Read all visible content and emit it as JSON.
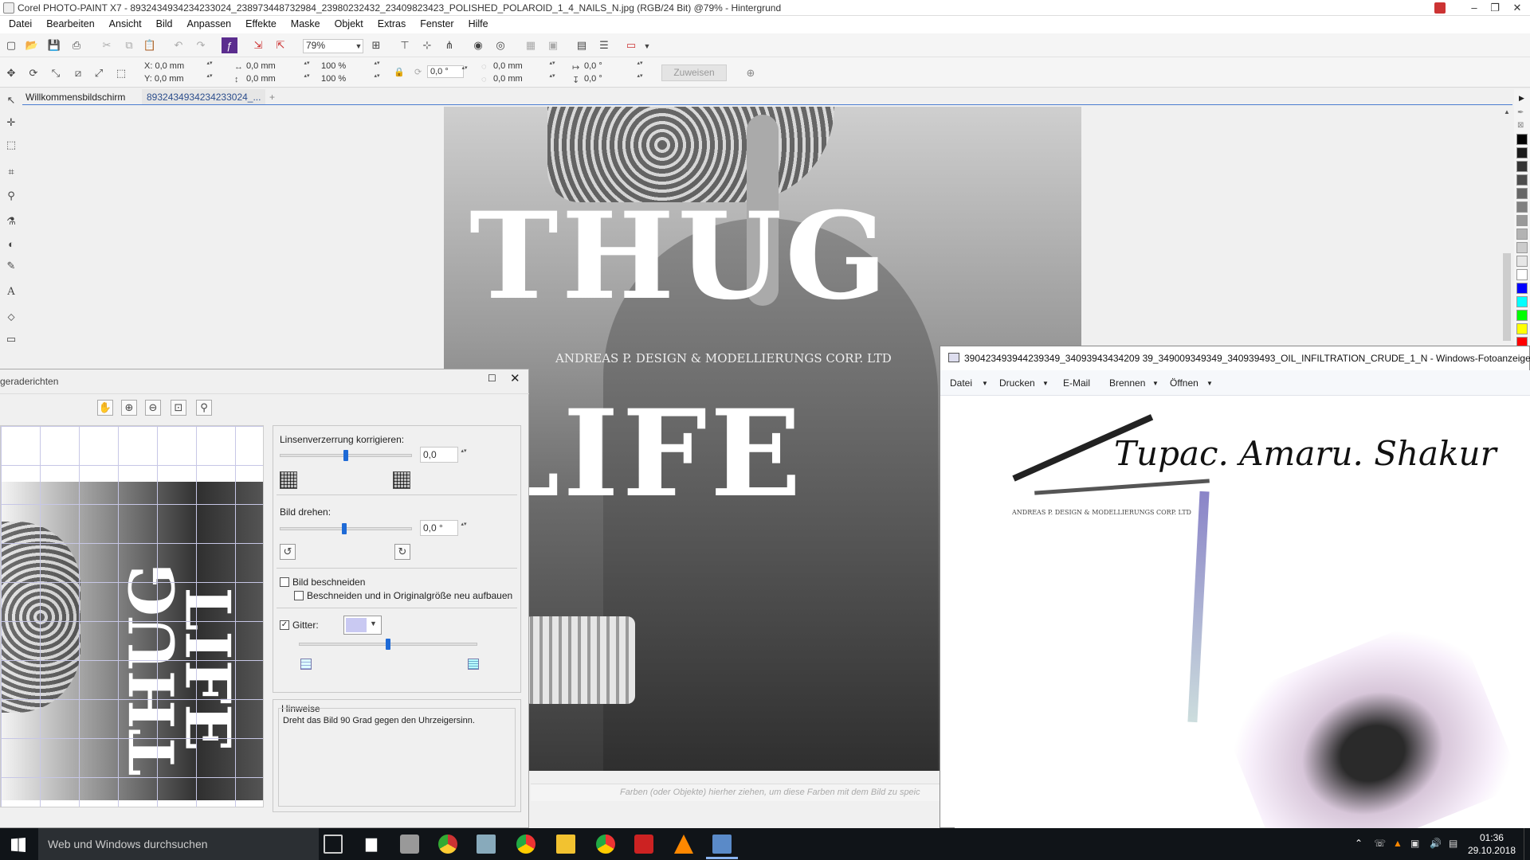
{
  "window": {
    "title": "Corel PHOTO-PAINT X7 - 8932434934234233024_238973448732984_23980232432_23409823423_POLISHED_POLAROID_1_4_NAILS_N.jpg (RGB/24 Bit) @79% - Hintergrund",
    "min": "–",
    "max": "❐",
    "close": "✕"
  },
  "menu": [
    "Datei",
    "Bearbeiten",
    "Ansicht",
    "Bild",
    "Anpassen",
    "Effekte",
    "Maske",
    "Objekt",
    "Extras",
    "Fenster",
    "Hilfe"
  ],
  "toolbar": {
    "zoom": "79%",
    "apply_label": "Zuweisen"
  },
  "props": {
    "x": "X: 0,0 mm",
    "y": "Y: 0,0 mm",
    "w": "0,0 mm",
    "h": "0,0 mm",
    "sx": "100 %",
    "sy": "100 %",
    "rot": "0,0 °",
    "cx": "0,0 mm",
    "cy": "0,0 mm",
    "skx": "0,0 °",
    "sky": "0,0 °"
  },
  "tabs": {
    "welcome": "Willkommensbildschirm",
    "doc": "8932434934234233024_...",
    "add": "+"
  },
  "canvas": {
    "thug": "THUG",
    "life": "LIFE",
    "credit": "ANDREAS P. DESIGN & MODELLIERUNGS CORP. LTD",
    "colorbar_hint": "Farben (oder Objekte) hierher ziehen, um diese Farben mit dem Bild zu speic"
  },
  "palette_colors": [
    "#000000",
    "#1a1a1a",
    "#333333",
    "#4d4d4d",
    "#666666",
    "#808080",
    "#999999",
    "#b3b3b3",
    "#cccccc",
    "#e6e6e6",
    "#ffffff",
    "#0000ff",
    "#00ffff",
    "#00ff00",
    "#ffff00",
    "#ff0000"
  ],
  "dialog": {
    "title": "geraderichten",
    "lens_label": "Linsenverzerrung korrigieren:",
    "lens_value": "0,0",
    "rotate_label": "Bild drehen:",
    "rotate_value": "0,0 °",
    "crop_label": "Bild beschneiden",
    "crop_rebuild_label": "Beschneiden und in Originalgröße neu aufbauen",
    "grid_label": "Gitter:",
    "grid_color": "#c9c9f2",
    "hints_title": "Hinweise",
    "hints_text": "Dreht das Bild 90 Grad gegen den Uhrzeigersinn.",
    "lens_level": 0.5,
    "rotate_level": 0.49,
    "grid_level": 0.5
  },
  "viewer": {
    "title": "390423493944239349_34093943434209 39_349009349349_340939493_OIL_INFILTRATION_CRUDE_1_N - Windows-Fotoanzeige",
    "menu": [
      "Datei",
      "Drucken",
      "E-Mail",
      "Brennen",
      "Öffnen"
    ],
    "script": "Tupac. Amaru. Shakur",
    "credit": "ANDREAS P. DESIGN & MODELLIERUNGS CORP. LTD"
  },
  "taskbar": {
    "search": "Web und Windows durchsuchen",
    "time": "01:36",
    "date": "29.10.2018"
  }
}
